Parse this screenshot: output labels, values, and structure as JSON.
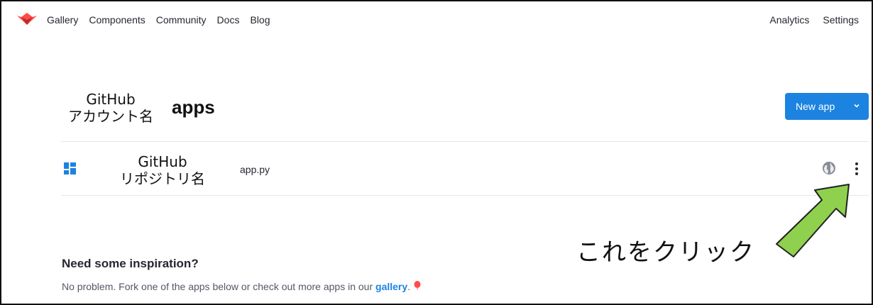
{
  "nav": {
    "left": [
      "Gallery",
      "Components",
      "Community",
      "Docs",
      "Blog"
    ],
    "right": [
      "Analytics",
      "Settings"
    ]
  },
  "header": {
    "owner_label_line1": "GitHub",
    "owner_label_line2": "アカウント名",
    "title": "apps",
    "new_app_button": "New app"
  },
  "app_row": {
    "repo_label_line1": "GitHub",
    "repo_label_line2": "リポジトリ名",
    "file": "app.py"
  },
  "annotation": {
    "text": "これをクリック"
  },
  "inspiration": {
    "heading": "Need some inspiration?",
    "text_before": "No problem. Fork one of the apps below or check out more apps in our ",
    "link": "gallery",
    "text_after": "."
  },
  "colors": {
    "accent": "#1c83e1",
    "logo": "#ff4b4b",
    "arrow_fill": "#8fd14f"
  },
  "icons": [
    "streamlit-logo-icon",
    "dashboard-grid-icon",
    "globe-icon",
    "more-vertical-icon",
    "chevron-down-icon",
    "balloon-icon"
  ]
}
